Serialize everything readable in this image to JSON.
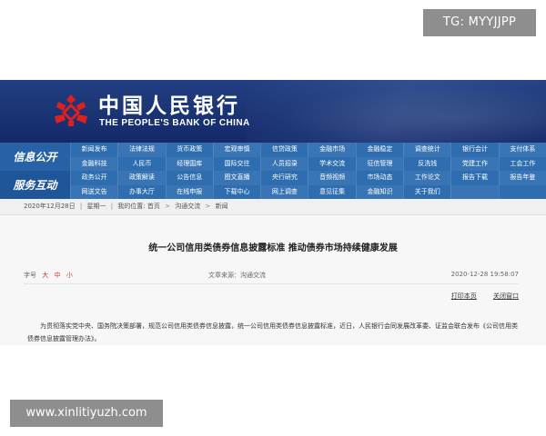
{
  "watermark_top": "TG: MYYJJPP",
  "watermark_bottom": "www.xinlitiyuzh.com",
  "header": {
    "brand_cn": "中国人民银行",
    "brand_en": "THE PEOPLE'S BANK OF CHINA",
    "emblem_icon": "pboc-emblem-icon",
    "emblem_color": "#e02020"
  },
  "nav": {
    "band_1": "信息公开",
    "band_2": "服务互动",
    "rows": [
      [
        "新闻发布",
        "法律法规",
        "货币政策",
        "宏观审慎",
        "信贷政策",
        "金融市场",
        "金融稳定",
        "调查统计",
        "银行会计",
        "支付体系"
      ],
      [
        "金融科技",
        "人民币",
        "经理国库",
        "国际交往",
        "人员招录",
        "学术交流",
        "征信管理",
        "反洗钱",
        "党建工作",
        "工会工作"
      ],
      [
        "政务公开",
        "政策解读",
        "公告信息",
        "图文直播",
        "央行研究",
        "音频视频",
        "市场动态",
        "工作论文",
        "报告下载",
        "报告年鉴"
      ],
      [
        "网送文告",
        "办事大厅",
        "在线申报",
        "下载中心",
        "网上调查",
        "意见征集",
        "金融知识",
        "关于我们",
        "",
        ""
      ]
    ]
  },
  "breadcrumb": {
    "date": "2020年12月28日",
    "weekday": "星期一",
    "position_label": "我的位置:",
    "home": "首页",
    "level_1": "沟通交流",
    "level_2": "新闻"
  },
  "article": {
    "title": "统一公司信用类债券信息披露标准 推动债券市场持续健康发展",
    "font_label": "字号",
    "font_large": "大",
    "font_medium": "中",
    "font_small": "小",
    "source": "文章来源：沟通交流",
    "timestamp": "2020-12-28 19:58:07",
    "print_link": "打印本页",
    "close_link": "关闭窗口",
    "body": "为贯彻落实党中央、国务院决策部署，规范公司信用类债券信息披露，统一公司信用类债券信息披露标准，近日，人民银行会同发展改革委、证监会联合发布《公司信用类债券信息披露管理办法》。"
  }
}
